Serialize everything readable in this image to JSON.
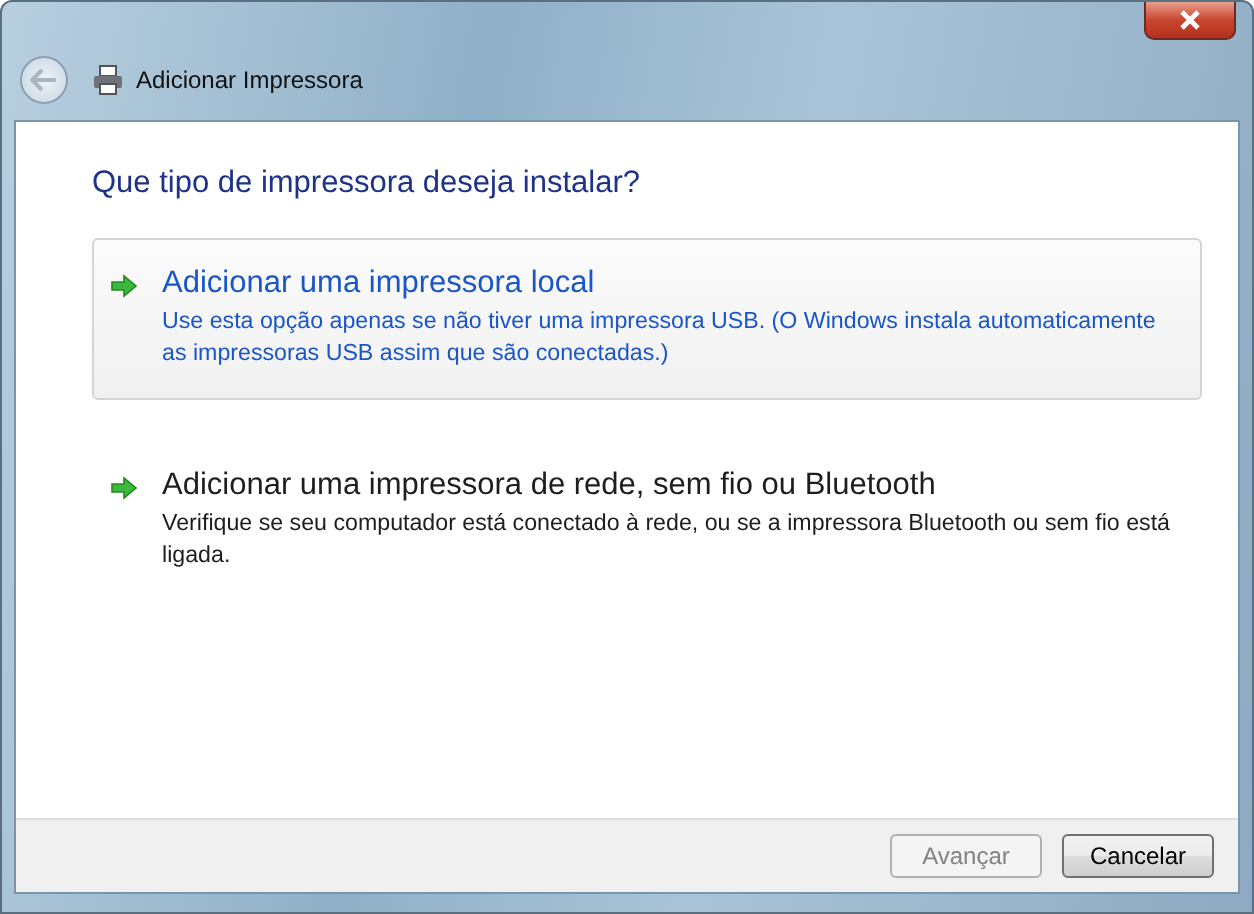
{
  "window": {
    "title": "Adicionar Impressora",
    "back_disabled": true
  },
  "heading": "Que tipo de impressora deseja instalar?",
  "options": [
    {
      "title": "Adicionar uma impressora local",
      "description": "Use esta opção apenas se não tiver uma impressora USB. (O Windows instala automaticamente as impressoras USB assim que são conectadas.)",
      "hovered": true
    },
    {
      "title": "Adicionar uma impressora de rede, sem fio ou Bluetooth",
      "description": "Verifique se seu computador está conectado à rede, ou se a impressora Bluetooth ou sem fio está ligada.",
      "hovered": false
    }
  ],
  "buttons": [
    {
      "label": "Avançar",
      "disabled": true
    },
    {
      "label": "Cancelar",
      "disabled": false
    }
  ]
}
